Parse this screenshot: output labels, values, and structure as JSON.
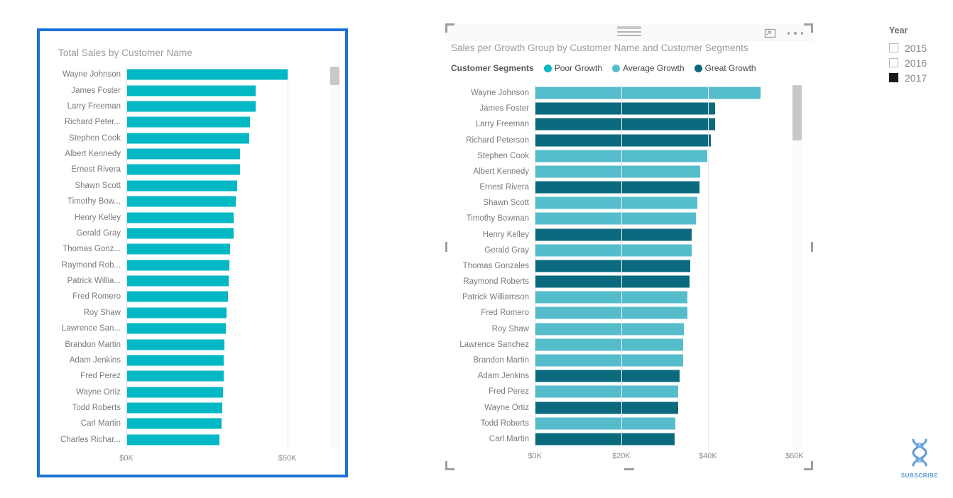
{
  "left_chart": {
    "title": "Total Sales by Customer Name",
    "scrollbar": "vertical-scrollbar"
  },
  "right_chart": {
    "title": "Sales per Growth Group by Customer Name and Customer Segments",
    "legend_title": "Customer Segments",
    "expand_icon": "focus-mode-icon",
    "more_icon": "more-options-icon",
    "drag_handle": "drag-handle-icon",
    "scrollbar": "vertical-scrollbar"
  },
  "slicer": {
    "title": "Year",
    "options": [
      {
        "label": "2015",
        "checked": false
      },
      {
        "label": "2016",
        "checked": false
      },
      {
        "label": "2017",
        "checked": true
      }
    ]
  },
  "watermark": {
    "label": "SUBSCRIBE",
    "icon": "dna-helix-icon"
  },
  "colors": {
    "poor_growth": "#01B8C4",
    "average_growth": "#55BCCB",
    "great_growth": "#0C6A7F",
    "selection_border": "#1a73d4",
    "axis_text": "#8a8a8a",
    "label_text": "#7b7b7b",
    "title_text": "#9a9a9a"
  },
  "chart_data": [
    {
      "type": "bar",
      "orientation": "horizontal",
      "title": "Total Sales by Customer Name",
      "xlabel": "",
      "ylabel": "",
      "xlim": [
        0,
        60000
      ],
      "xticks": [
        0,
        50000
      ],
      "xtick_labels": [
        "$0K",
        "$50K"
      ],
      "grid": true,
      "series_color": "#01B8C4",
      "categories": [
        "Wayne Johnson",
        "James Foster",
        "Larry Freeman",
        "Richard Peter...",
        "Stephen Cook",
        "Albert Kennedy",
        "Ernest Rivera",
        "Shawn Scott",
        "Timothy Bow...",
        "Henry Kelley",
        "Gerald Gray",
        "Thomas Gonz...",
        "Raymond Rob...",
        "Patrick Willia...",
        "Fred Romero",
        "Roy Shaw",
        "Lawrence San...",
        "Brandon Martin",
        "Adam Jenkins",
        "Fred Perez",
        "Wayne Ortiz",
        "Todd Roberts",
        "Carl Martin",
        "Charles Richar..."
      ],
      "values": [
        50200,
        40200,
        40100,
        38400,
        38100,
        35400,
        35300,
        34500,
        34000,
        33300,
        33200,
        32100,
        32000,
        31700,
        31600,
        31000,
        30900,
        30500,
        30300,
        30200,
        30000,
        29700,
        29500,
        29000
      ]
    },
    {
      "type": "bar",
      "orientation": "horizontal",
      "title": "Sales per Growth Group by Customer Name and Customer Segments",
      "xlabel": "",
      "ylabel": "",
      "xlim": [
        0,
        62000
      ],
      "xticks": [
        0,
        20000,
        40000,
        60000
      ],
      "xtick_labels": [
        "$0K",
        "$20K",
        "$40K",
        "$60K"
      ],
      "grid": true,
      "legend_title": "Customer Segments",
      "legend_position": "top",
      "legend": [
        {
          "name": "Poor Growth",
          "color": "#01B8C4"
        },
        {
          "name": "Average Growth",
          "color": "#55BCCB"
        },
        {
          "name": "Great Growth",
          "color": "#0C6A7F"
        }
      ],
      "categories": [
        "Wayne Johnson",
        "James Foster",
        "Larry Freeman",
        "Richard Peterson",
        "Stephen Cook",
        "Albert Kennedy",
        "Ernest Rivera",
        "Shawn Scott",
        "Timothy Bowman",
        "Henry Kelley",
        "Gerald Gray",
        "Thomas Gonzales",
        "Raymond Roberts",
        "Patrick Williamson",
        "Fred Romero",
        "Roy Shaw",
        "Lawrence Sanchez",
        "Brandon Martin",
        "Adam Jenkins",
        "Fred Perez",
        "Wayne Ortiz",
        "Todd Roberts",
        "Carl Martin"
      ],
      "values": [
        52200,
        41700,
        41600,
        40700,
        39800,
        38200,
        38100,
        37600,
        37300,
        36300,
        36200,
        35900,
        35800,
        35300,
        35200,
        34500,
        34300,
        34200,
        33400,
        33200,
        33100,
        32500,
        32300
      ],
      "segments": [
        "Average Growth",
        "Great Growth",
        "Great Growth",
        "Great Growth",
        "Average Growth",
        "Average Growth",
        "Great Growth",
        "Average Growth",
        "Average Growth",
        "Great Growth",
        "Average Growth",
        "Great Growth",
        "Great Growth",
        "Average Growth",
        "Average Growth",
        "Average Growth",
        "Average Growth",
        "Average Growth",
        "Great Growth",
        "Average Growth",
        "Great Growth",
        "Average Growth",
        "Great Growth"
      ]
    }
  ]
}
